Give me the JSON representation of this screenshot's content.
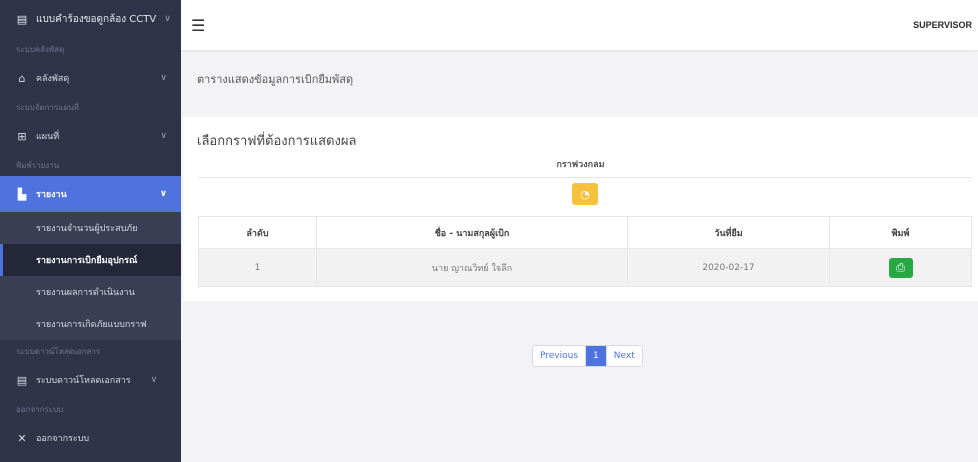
{
  "sidebar": {
    "top_item": "แบบคำร้องขอดูกล้อง CCTV",
    "sections": [
      {
        "heading": "ระบบคลังพัสดุ",
        "item": "คลังพัสดุ"
      },
      {
        "heading": "ระบบจัดการแผนที่",
        "item": "แผนที่"
      },
      {
        "heading": "พิมพ์รายงาน",
        "item": "รายงาน"
      }
    ],
    "report_subitems": [
      "รายงานจำนวนผู้ประสบภัย",
      "รายงานการเบิกยืมอุปกรณ์",
      "รายงานผลการดำเนินงาน",
      "รายงานการเกิดภัยแบบกราฟ"
    ],
    "docs_heading": "ระบบดาวน์โหลดเอกสาร",
    "docs_item": "ระบบดาวน์โหลดเอกสาร",
    "logout_heading": "ออกจากระบบ",
    "logout_item": "ออกจากระบบ"
  },
  "topbar": {
    "user": "SUPERVISOR"
  },
  "page": {
    "title": "ตารางแสดงข้อมูลการเบิกยืมพัสดุ"
  },
  "card": {
    "title": "เลือกกราฟที่ต้องการแสดงผล",
    "subtitle": "กราฟวงกลม"
  },
  "table": {
    "headers": [
      "ลำดับ",
      "ชื่อ - นามสกุลผู้เบิก",
      "วันที่ยืม",
      "พิมพ์"
    ],
    "rows": [
      {
        "no": "1",
        "name": "นาย ญาณวิทย์ ใจลึก",
        "date": "2020-02-17"
      }
    ]
  },
  "pagination": {
    "previous": "Previous",
    "page": "1",
    "next": "Next"
  },
  "colors": {
    "sidebar": "#2f3448",
    "accent": "#4e73df",
    "warning": "#f6c23e",
    "success": "#28a745"
  },
  "icons": {
    "top_item": "form-icon",
    "stock": "home-icon",
    "map": "map-icon",
    "report": "chart-icon",
    "docs": "document-icon",
    "logout": "close-icon",
    "chart_button": "pie-chart-icon",
    "print": "print-icon"
  }
}
